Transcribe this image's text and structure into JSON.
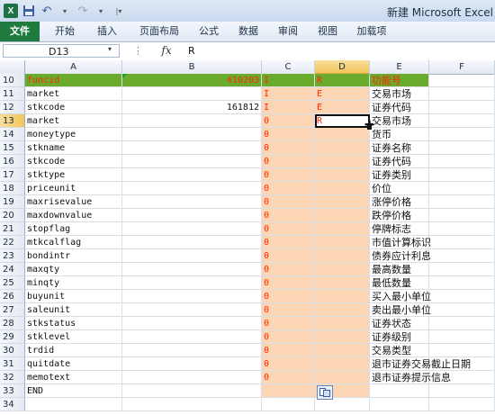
{
  "window": {
    "title": "新建 Microsoft Excel"
  },
  "quick_access": {
    "logo_letter": "X",
    "save_icon": "save-icon",
    "undo_icon": "undo-icon",
    "redo_icon": "redo-icon",
    "customize_icon": "chevron-down-icon"
  },
  "ribbon": {
    "tabs": [
      {
        "label": "文件"
      },
      {
        "label": "开始"
      },
      {
        "label": "插入"
      },
      {
        "label": "页面布局"
      },
      {
        "label": "公式"
      },
      {
        "label": "数据"
      },
      {
        "label": "审阅"
      },
      {
        "label": "视图"
      },
      {
        "label": "加载项"
      }
    ]
  },
  "formula_bar": {
    "name_box": "D13",
    "fx_label": "fx",
    "value": "R"
  },
  "columns": [
    "A",
    "B",
    "C",
    "D",
    "E",
    "F"
  ],
  "rows": [
    {
      "num": "10",
      "A": "funcid",
      "B": "410203",
      "C": "I",
      "D": "R",
      "E": "功能号"
    },
    {
      "num": "11",
      "A": "market",
      "B": "",
      "C": "I",
      "D": "E",
      "E": "交易市场"
    },
    {
      "num": "12",
      "A": "stkcode",
      "B": "161812",
      "C": "I",
      "D": "E",
      "E": "证券代码"
    },
    {
      "num": "13",
      "A": "market",
      "B": "",
      "C": "0",
      "D": "R",
      "E": "交易市场"
    },
    {
      "num": "14",
      "A": "moneytype",
      "B": "",
      "C": "0",
      "D": "",
      "E": "货币"
    },
    {
      "num": "15",
      "A": "stkname",
      "B": "",
      "C": "0",
      "D": "",
      "E": "证券名称"
    },
    {
      "num": "16",
      "A": "stkcode",
      "B": "",
      "C": "0",
      "D": "",
      "E": "证券代码"
    },
    {
      "num": "17",
      "A": "stktype",
      "B": "",
      "C": "0",
      "D": "",
      "E": "证券类别"
    },
    {
      "num": "18",
      "A": "priceunit",
      "B": "",
      "C": "0",
      "D": "",
      "E": "价位"
    },
    {
      "num": "19",
      "A": "maxrisevalue",
      "B": "",
      "C": "0",
      "D": "",
      "E": "涨停价格"
    },
    {
      "num": "20",
      "A": "maxdownvalue",
      "B": "",
      "C": "0",
      "D": "",
      "E": "跌停价格"
    },
    {
      "num": "21",
      "A": "stopflag",
      "B": "",
      "C": "0",
      "D": "",
      "E": "停牌标志"
    },
    {
      "num": "22",
      "A": "mtkcalflag",
      "B": "",
      "C": "0",
      "D": "",
      "E": "市值计算标识"
    },
    {
      "num": "23",
      "A": "bondintr",
      "B": "",
      "C": "0",
      "D": "",
      "E": "债券应计利息"
    },
    {
      "num": "24",
      "A": "maxqty",
      "B": "",
      "C": "0",
      "D": "",
      "E": "最高数量"
    },
    {
      "num": "25",
      "A": "minqty",
      "B": "",
      "C": "0",
      "D": "",
      "E": "最低数量"
    },
    {
      "num": "26",
      "A": "buyunit",
      "B": "",
      "C": "0",
      "D": "",
      "E": "买入最小单位"
    },
    {
      "num": "27",
      "A": "saleunit",
      "B": "",
      "C": "0",
      "D": "",
      "E": "卖出最小单位"
    },
    {
      "num": "28",
      "A": "stkstatus",
      "B": "",
      "C": "0",
      "D": "",
      "E": "证券状态"
    },
    {
      "num": "29",
      "A": "stklevel",
      "B": "",
      "C": "0",
      "D": "",
      "E": "证券级别"
    },
    {
      "num": "30",
      "A": "trdid",
      "B": "",
      "C": "0",
      "D": "",
      "E": "交易类型"
    },
    {
      "num": "31",
      "A": "quitdate",
      "B": "",
      "C": "0",
      "D": "",
      "E": "退市证券交易截止日期"
    },
    {
      "num": "32",
      "A": "memotext",
      "B": "",
      "C": "0",
      "D": "",
      "E": "退市证券提示信息"
    },
    {
      "num": "33",
      "A": "END",
      "B": "",
      "C": "",
      "D": "",
      "E": ""
    },
    {
      "num": "34",
      "A": "",
      "B": "",
      "C": "",
      "D": "",
      "E": ""
    }
  ],
  "selection": {
    "cell": "D13",
    "row": "13",
    "column": "D"
  },
  "colors": {
    "header_row_fill": "#6aab2e",
    "io_column_fill": "#fcd5b4",
    "io_text": "#ff2a00",
    "file_tab": "#1f7a3e"
  }
}
